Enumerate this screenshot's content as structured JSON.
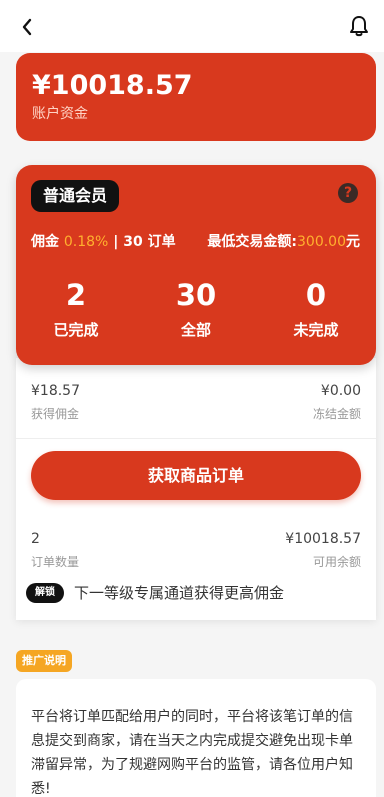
{
  "header": {
    "back_icon": "chevron-left-icon",
    "notification_icon": "bell-icon"
  },
  "balance": {
    "amount": "¥10018.57",
    "label": "账户资金"
  },
  "member": {
    "level": "普通会员",
    "help_icon": "question-circle-icon",
    "commission_label": "佣金",
    "commission_rate": "0.18%",
    "order_quota": "30 订单",
    "min_label": "最低交易金额:",
    "min_amount": "300.00",
    "min_unit": "元",
    "stats": [
      {
        "value": "2",
        "label": "已完成"
      },
      {
        "value": "30",
        "label": "全部"
      },
      {
        "value": "0",
        "label": "未完成"
      }
    ]
  },
  "details": {
    "earned_value": "¥18.57",
    "earned_label": "获得佣金",
    "frozen_value": "¥0.00",
    "frozen_label": "冻结金额",
    "order_button": "获取商品订单",
    "order_count_value": "2",
    "order_count_label": "订单数量",
    "available_value": "¥10018.57",
    "available_label": "可用余额",
    "unlock_tag": "解锁",
    "unlock_text": "下一等级专属通道获得更高佣金"
  },
  "promo": {
    "tag": "推广说明",
    "text": "平台将订单匹配给用户的同时，平台将该笔订单的信息提交到商家，请在当天之内完成提交避免出现卡单滞留异常，为了规避网购平台的监管，请各位用户知悉!"
  },
  "colors": {
    "primary": "#d8391e",
    "accent": "#ffb02e",
    "promo_tag": "#f5a623"
  }
}
